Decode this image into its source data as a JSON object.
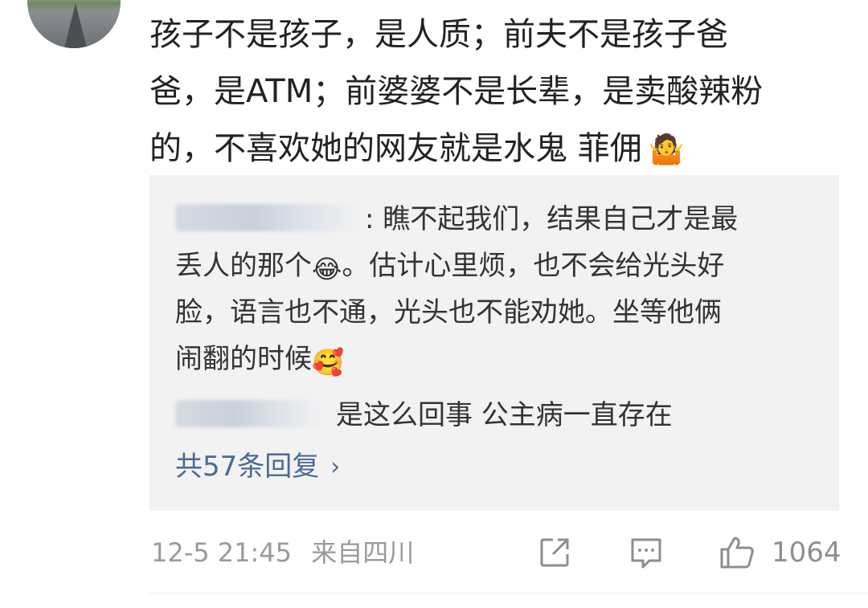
{
  "comment": {
    "line1": "孩子不是孩子，是人质；前夫不是孩子爸",
    "line2": "爸，是ATM；前婆婆不是长辈，是卖酸辣粉",
    "line3": "的，不喜欢她的网友就是水鬼 菲佣",
    "emoji": "🤷"
  },
  "replies": {
    "first": {
      "text_part1": ": 瞧不起我们，结果自己才是最",
      "text_part2": "丢人的那个",
      "emoji_laugh": "😂",
      "text_part3": "。估计心里烦，也不会给光头好",
      "text_part4": "脸，语言也不通，光头也不能劝她。坐等他俩",
      "text_part5": "闹翻的时候",
      "emoji_yum": "🥰"
    },
    "second": {
      "text": "是这么回事 公主病一直存在"
    },
    "more_label": "共57条回复",
    "more_chevron": "›"
  },
  "meta": {
    "datetime": "12-5 21:45",
    "location": "来自四川"
  },
  "actions": {
    "like_count": "1064"
  }
}
